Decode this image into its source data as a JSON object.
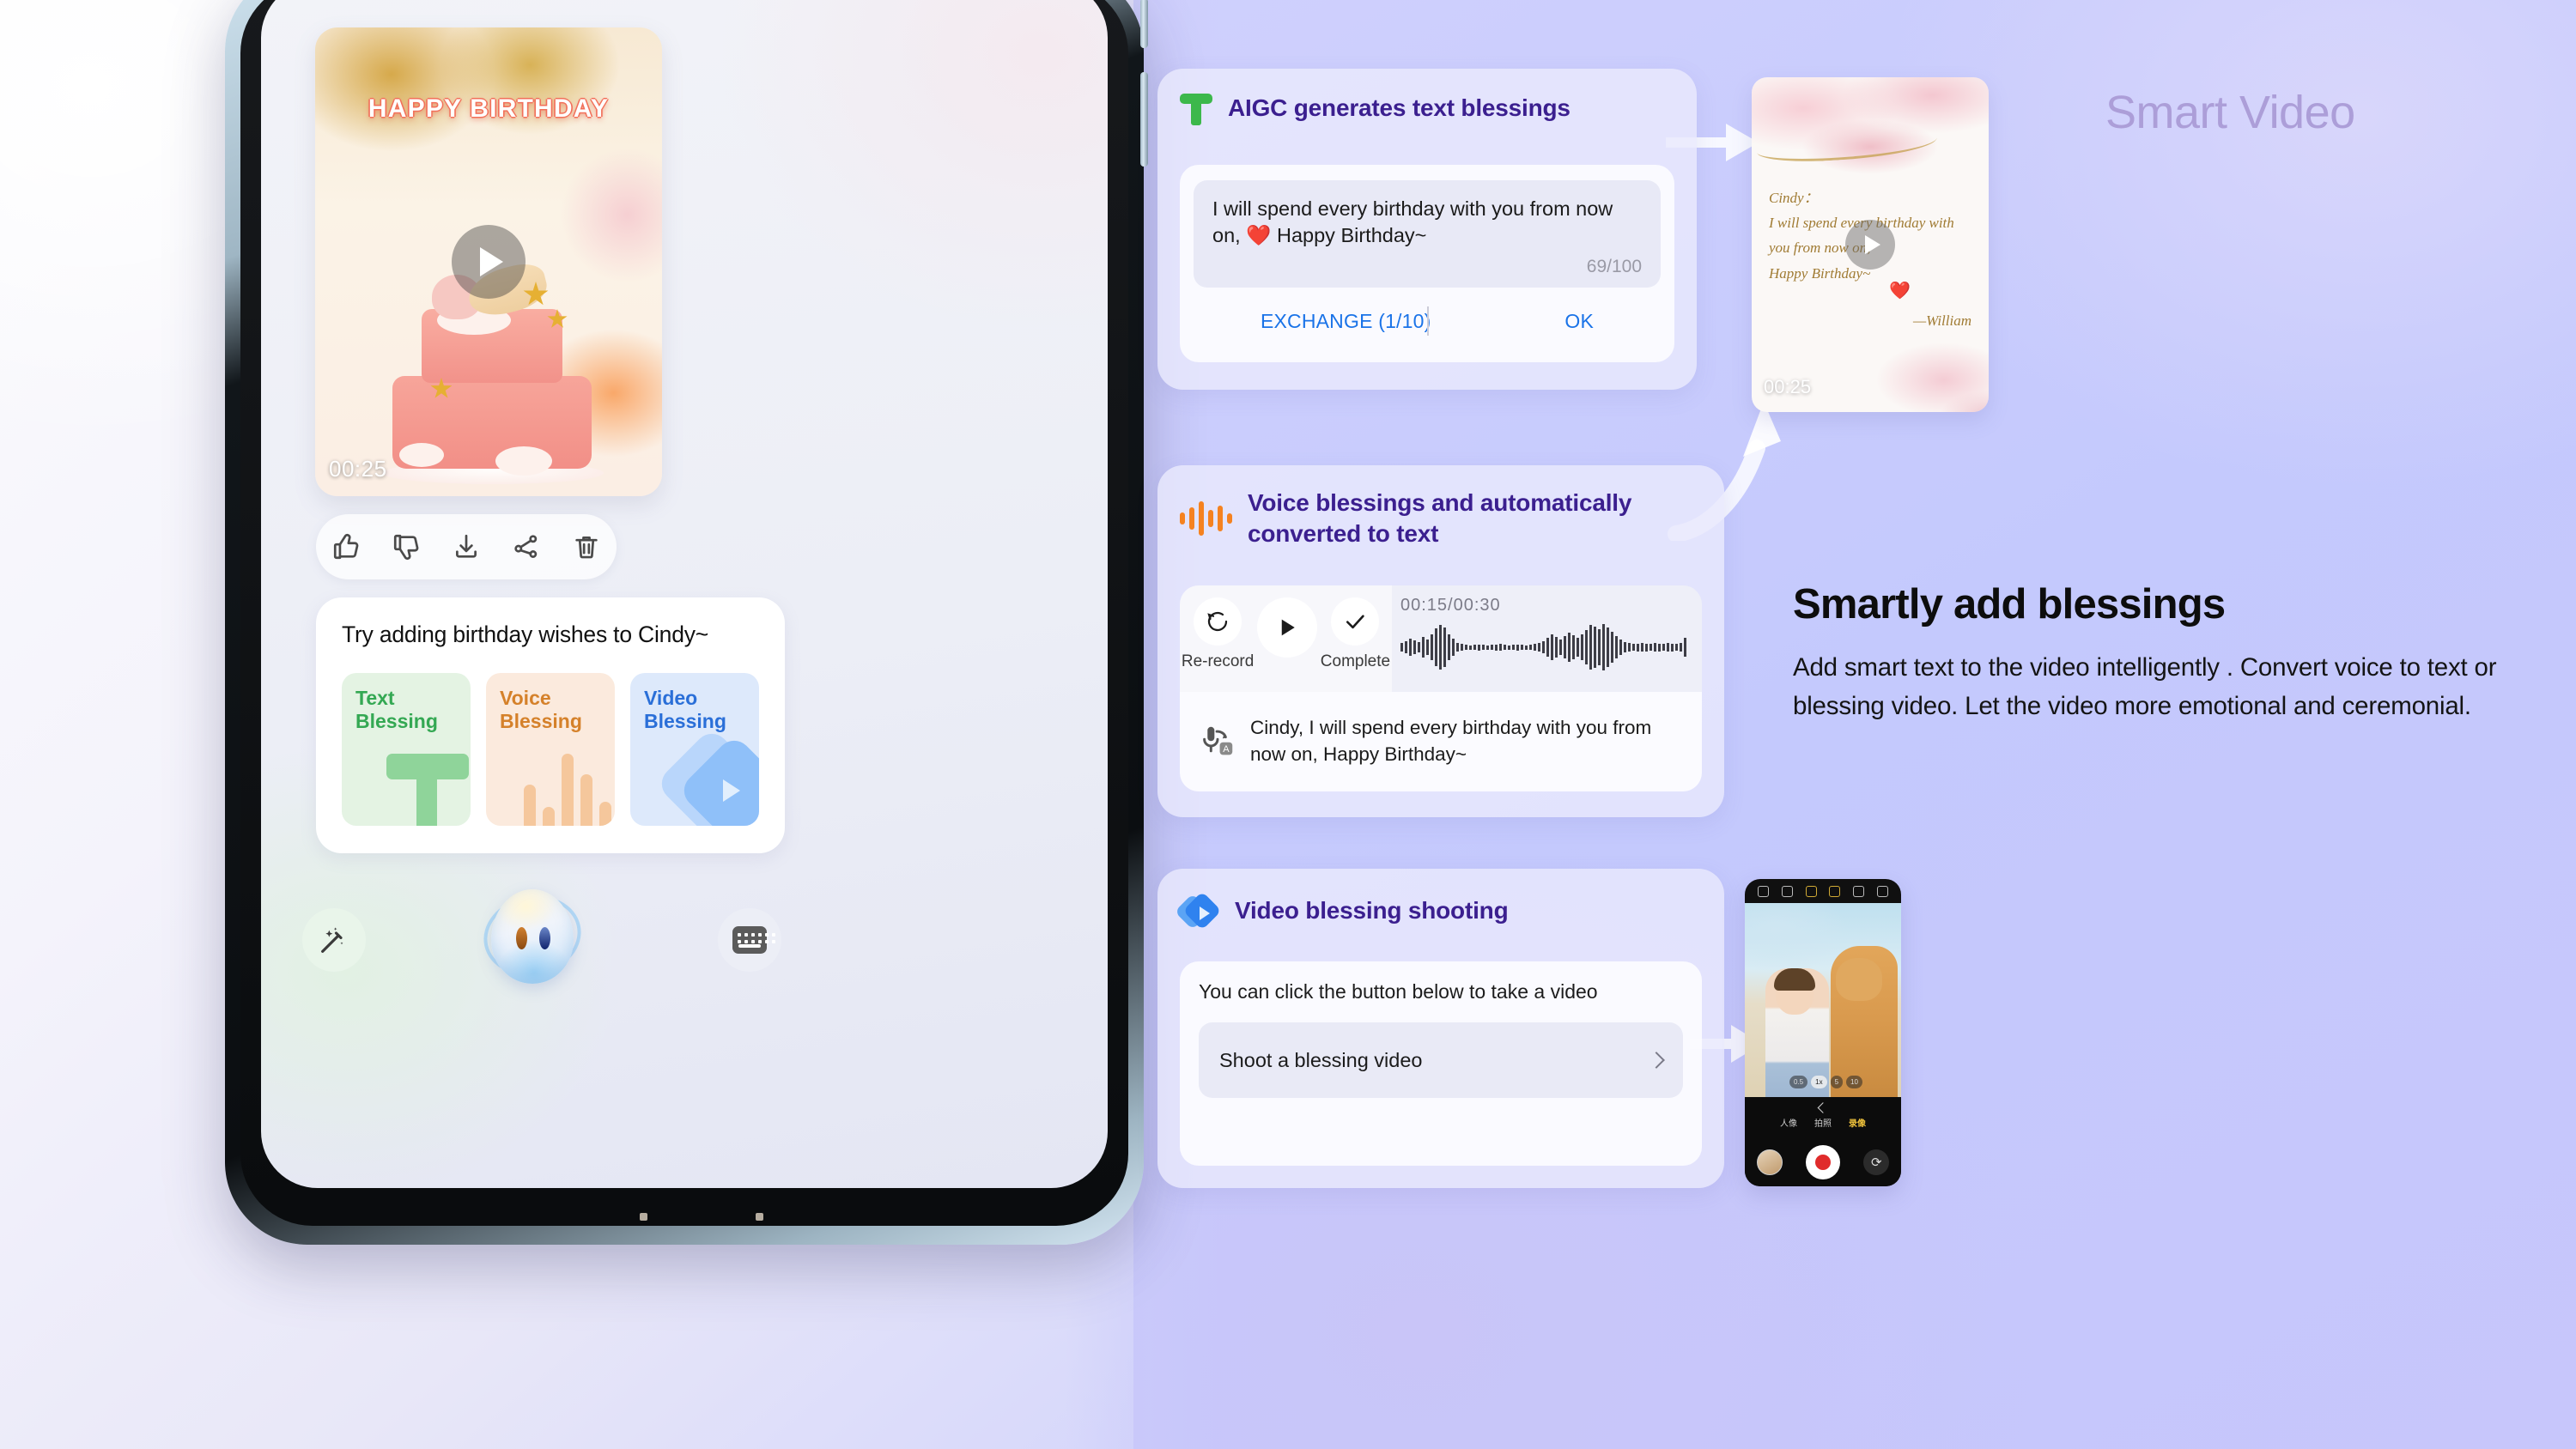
{
  "watermark": "Smart Video",
  "copy": {
    "heading": "Smartly add blessings",
    "body": "Add smart text to the video intelligently . Convert voice to text or blessing video. Let the video more emotional and ceremonial."
  },
  "phone": {
    "video_thumb": {
      "overlay_title": "HAPPY BIRTHDAY",
      "duration": "00:25",
      "play_icon": "play-icon"
    },
    "actions": [
      {
        "name": "thumbs-up-icon",
        "label": "Like"
      },
      {
        "name": "thumbs-down-icon",
        "label": "Dislike"
      },
      {
        "name": "download-icon",
        "label": "Download"
      },
      {
        "name": "share-icon",
        "label": "Share"
      },
      {
        "name": "trash-icon",
        "label": "Delete"
      }
    ],
    "suggestion": {
      "title": "Try adding birthday wishes to Cindy~",
      "options": [
        {
          "label_line1": "Text",
          "label_line2": "Blessing",
          "color": "#34a853",
          "bg": "#e4f3e3",
          "glyph": "text-t-glyph"
        },
        {
          "label_line1": "Voice",
          "label_line2": "Blessing",
          "color": "#d5812a",
          "bg": "#fbeadd",
          "glyph": "waveform-glyph"
        },
        {
          "label_line1": "Video",
          "label_line2": "Blessing",
          "color": "#2a6fd8",
          "bg": "#dde9fb",
          "glyph": "video-diamond-glyph"
        }
      ]
    },
    "dock": {
      "magic_wand": "magic-wand-icon",
      "assistant": "assistant-orb-icon",
      "keyboard": "keyboard-icon"
    }
  },
  "cards": {
    "aigc": {
      "icon": "text-t-icon",
      "title": "AIGC generates text blessings",
      "text": "I will spend every birthday with you from now on, ❤️ Happy Birthday~",
      "counter": "69/100",
      "exchange_label": "EXCHANGE (1/10)",
      "ok_label": "OK",
      "link_color": "#1a73e8"
    },
    "voice": {
      "icon": "voice-waveform-icon",
      "title": "Voice blessings and automatically converted to text",
      "rerecord_label": "Re-record",
      "play_icon": "play-icon",
      "complete_label": "Complete",
      "time": "00:15/00:30",
      "transcript_icon": "mic-to-text-icon",
      "transcript": "Cindy, I will spend every birthday with you from now on, Happy Birthday~"
    },
    "shoot": {
      "icon": "video-diamond-icon",
      "title": "Video blessing shooting",
      "hint": "You can click the button below to take a video",
      "button_label": "Shoot a blessing video",
      "chevron": "chevron-right-icon"
    }
  },
  "preview": {
    "salutation": "Cindy：",
    "line1": "I will spend every birthday with",
    "line2": "you from now on,",
    "line3": "Happy Birthday~",
    "heart": "❤️",
    "signature": "—William",
    "duration": "00:25",
    "play_icon": "play-icon"
  },
  "camera": {
    "toolbar_icons": [
      "flash-off-icon",
      "filter-icon",
      "ai-icon",
      "hdr-icon",
      "beauty-icon",
      "settings-icon"
    ],
    "zoom_levels": [
      "0.5",
      "1x",
      "5",
      "10"
    ],
    "zoom_active": "1x",
    "modes": [
      "人像",
      "拍照",
      "录像"
    ],
    "mode_active": "录像",
    "gallery_thumb": "gallery-thumbnail",
    "shutter": "record-button",
    "flip": "flip-camera-icon"
  },
  "colors": {
    "background_right": "#c4c9fd",
    "card_title": "#3b1f8f",
    "accent_green": "#3cb84b",
    "accent_orange": "#f58220",
    "accent_blue": "#2f82ef",
    "link_blue": "#1a73e8"
  }
}
